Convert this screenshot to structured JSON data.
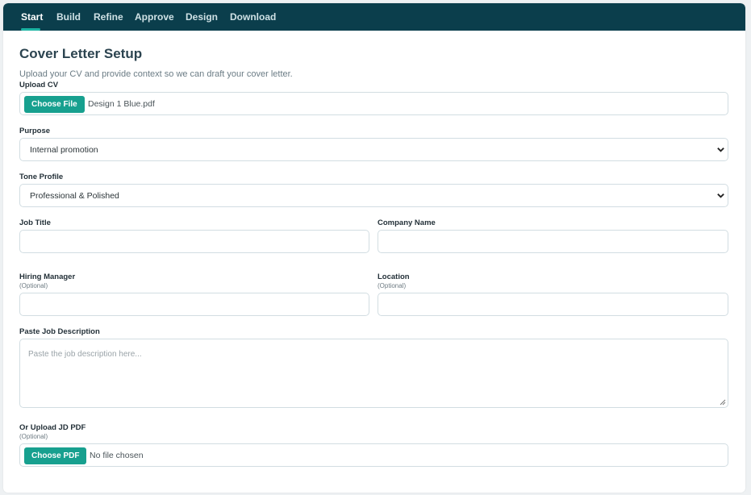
{
  "nav": {
    "tabs": [
      {
        "label": "Start",
        "active": true
      },
      {
        "label": "Build"
      },
      {
        "label": "Refine"
      },
      {
        "label": "Approve"
      },
      {
        "label": "Design"
      },
      {
        "label": "Download"
      }
    ]
  },
  "header": {
    "title": "Cover Letter Setup",
    "subtitle": "Upload your CV and provide context so we can draft your cover letter."
  },
  "upload_cv": {
    "label": "Upload CV",
    "button": "Choose File",
    "file_name": "Design 1 Blue.pdf"
  },
  "purpose": {
    "label": "Purpose",
    "value": "Internal promotion"
  },
  "tone": {
    "label": "Tone Profile",
    "value": "Professional & Polished"
  },
  "job_title": {
    "label": "Job Title",
    "value": ""
  },
  "company_name": {
    "label": "Company Name",
    "value": ""
  },
  "hiring_manager": {
    "label": "Hiring Manager",
    "hint": "(Optional)",
    "value": ""
  },
  "location": {
    "label": "Location",
    "hint": "(Optional)",
    "value": ""
  },
  "job_description": {
    "label": "Paste Job Description",
    "placeholder": "Paste the job description here..."
  },
  "upload_jd": {
    "label": "Or Upload JD PDF",
    "hint": "(Optional)",
    "button": "Choose PDF",
    "file_name": "No file chosen"
  },
  "colors": {
    "nav_bg": "#0b3e4c",
    "accent": "#17a08f",
    "title": "#2c4450"
  },
  "icons": {
    "select_arrow": "chevron-down-icon",
    "resize": "resize-handle-icon"
  }
}
